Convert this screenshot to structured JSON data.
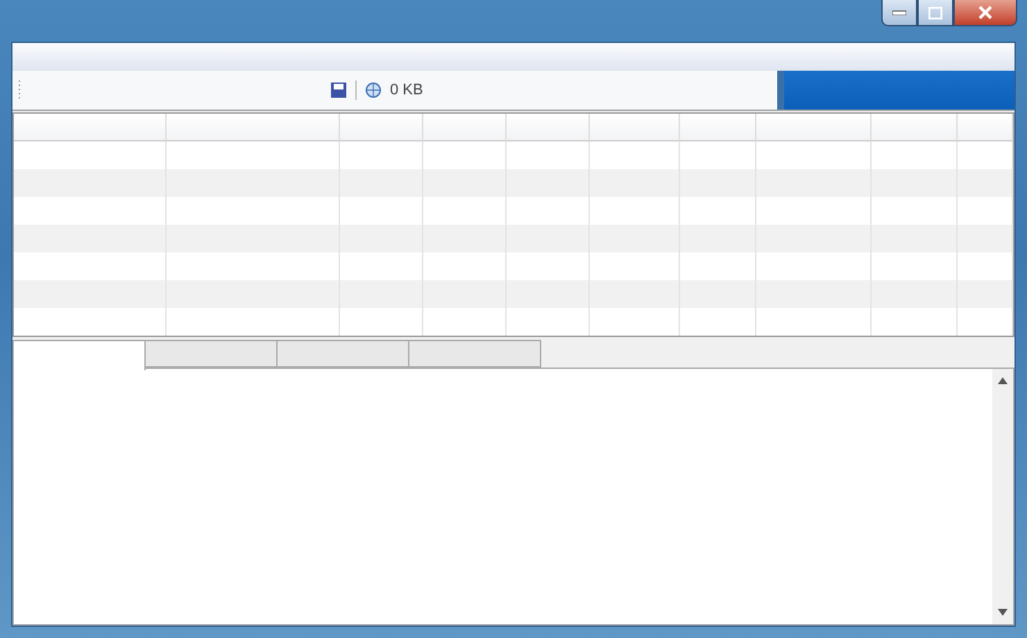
{
  "toolbar": {
    "status": "0 KB"
  },
  "tabs": [
    {
      "selected": true
    },
    {
      "selected": false
    },
    {
      "selected": false
    },
    {
      "selected": false
    }
  ]
}
